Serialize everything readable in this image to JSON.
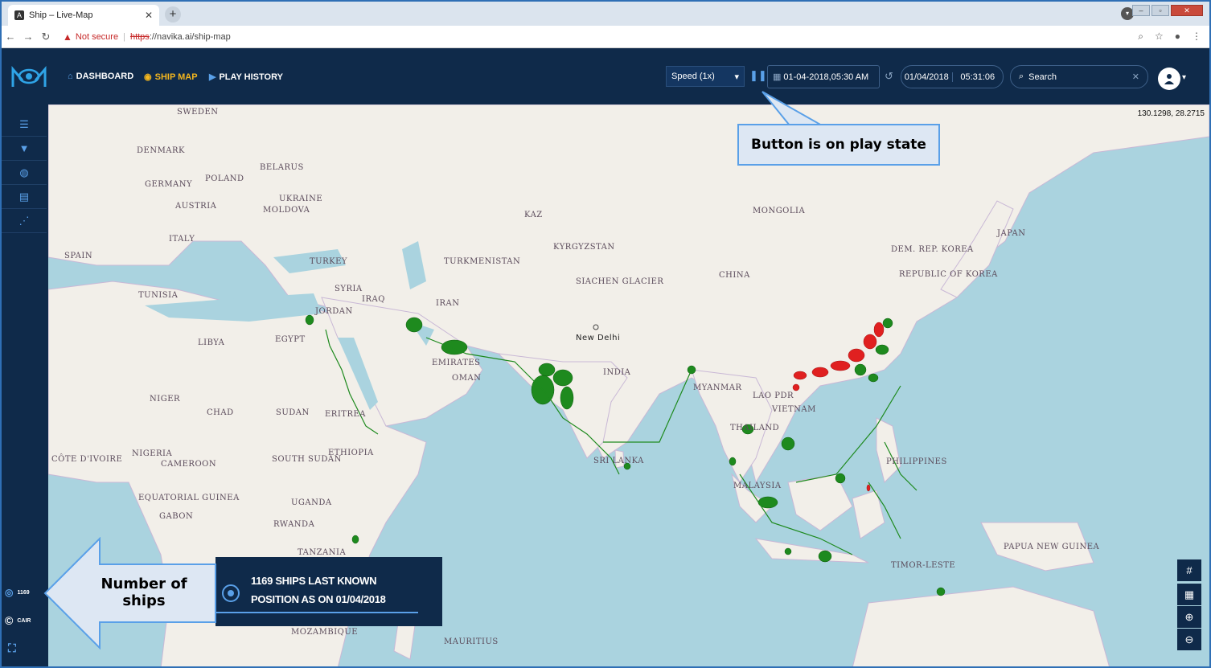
{
  "browser": {
    "tab_title": "Ship – Live-Map",
    "security_label": "Not secure",
    "url_scheme": "https",
    "url_rest": "://navika.ai/ship-map"
  },
  "header": {
    "nav": [
      {
        "label": "DASHBOARD",
        "icon": "home-icon"
      },
      {
        "label": "SHIP MAP",
        "icon": "target-icon"
      },
      {
        "label": "PLAY HISTORY",
        "icon": "play-circle-icon"
      }
    ],
    "speed_selected": "Speed (1x)",
    "datetime_value": "01-04-2018,05:30 AM",
    "clock_date": "01/04/2018",
    "clock_time": "05:31:06",
    "search_placeholder": "Search"
  },
  "map": {
    "coordinates": "130.1298, 28.2715",
    "labels": [
      {
        "text": "SWEDEN"
      },
      {
        "text": "DENMARK"
      },
      {
        "text": "GERMANY"
      },
      {
        "text": "POLAND"
      },
      {
        "text": "BELARUS"
      },
      {
        "text": "UKRAINE"
      },
      {
        "text": "MOLDOVA"
      },
      {
        "text": "AUSTRIA"
      },
      {
        "text": "ITALY"
      },
      {
        "text": "SPAIN"
      },
      {
        "text": "TURKEY"
      },
      {
        "text": "TUNISIA"
      },
      {
        "text": "SYRIA"
      },
      {
        "text": "IRAQ"
      },
      {
        "text": "JORDAN"
      },
      {
        "text": "IRAN"
      },
      {
        "text": "LIBYA"
      },
      {
        "text": "EGYPT"
      },
      {
        "text": "TURKMENISTAN"
      },
      {
        "text": "KYRGYZSTAN"
      },
      {
        "text": "MONGOLIA"
      },
      {
        "text": "CHINA"
      },
      {
        "text": "EMIRATES"
      },
      {
        "text": "OMAN"
      },
      {
        "text": "New Delhi"
      },
      {
        "text": "INDIA"
      },
      {
        "text": "MYANMAR"
      },
      {
        "text": "LAO PDR"
      },
      {
        "text": "VIETNAM"
      },
      {
        "text": "THAILAND"
      },
      {
        "text": "NIGER"
      },
      {
        "text": "CHAD"
      },
      {
        "text": "SUDAN"
      },
      {
        "text": "ERITREA"
      },
      {
        "text": "NIGERIA"
      },
      {
        "text": "ETHIOPIA"
      },
      {
        "text": "CAMEROON"
      },
      {
        "text": "SOUTH SUDAN"
      },
      {
        "text": "EQUATORIAL GUINEA"
      },
      {
        "text": "GABON"
      },
      {
        "text": "UGANDA"
      },
      {
        "text": "RWANDA"
      },
      {
        "text": "TANZANIA"
      },
      {
        "text": "MOZAMBIQUE"
      },
      {
        "text": "MAURITIUS"
      },
      {
        "text": "SRI LANKA"
      },
      {
        "text": "MALAYSIA"
      },
      {
        "text": "PHILIPPINES"
      },
      {
        "text": "TIMOR-LESTE"
      },
      {
        "text": "PAPUA NEW GUINEA"
      },
      {
        "text": "JAPAN"
      },
      {
        "text": "DEM. REP. KOREA"
      },
      {
        "text": "REPUBLIC OF KOREA"
      },
      {
        "text": "SIACHEN GLACIER"
      },
      {
        "text": "KAZ"
      },
      {
        "text": "CÔTE D'IVOIRE"
      }
    ]
  },
  "sidebar": {
    "ship_count": "1169",
    "brand": "CAIR"
  },
  "info_panel": {
    "line1": "1169 SHIPS LAST KNOWN",
    "line2": "POSITION AS ON 01/04/2018"
  },
  "callouts": {
    "play_state": "Button is on play state",
    "ships_line1": "Number of",
    "ships_line2": "ships"
  },
  "colors": {
    "header_bg": "#0f2a4a",
    "accent_active": "#f3b61f",
    "accent_blue": "#5aa0e8",
    "ship_normal": "#1e8a1e",
    "ship_alert": "#e02020",
    "water": "#aad3df",
    "land": "#f2efe9"
  }
}
